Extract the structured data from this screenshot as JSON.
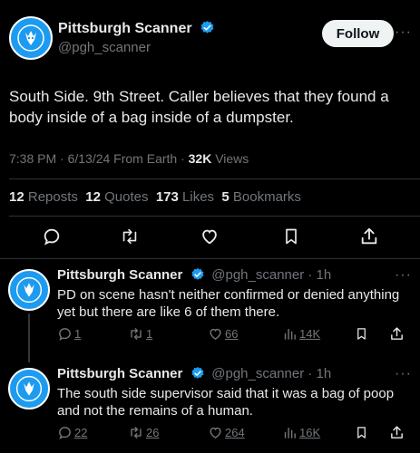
{
  "main_tweet": {
    "author_name": "Pittsburgh Scanner",
    "handle": "@pgh_scanner",
    "follow_label": "Follow",
    "more_label": "···",
    "text": "South Side.  9th Street.  Caller believes that they found a body inside of a bag inside of a dumpster.",
    "meta": {
      "time_date_source": "7:38 PM · 6/13/24 From Earth · ",
      "views_count": "32K",
      "views_label": " Views"
    },
    "stats": {
      "reposts_count": "12",
      "reposts_label": "Reposts",
      "quotes_count": "12",
      "quotes_label": "Quotes",
      "likes_count": "173",
      "likes_label": "Likes",
      "bookmarks_count": "5",
      "bookmarks_label": "Bookmarks"
    },
    "actions": [
      "reply-icon",
      "repost-icon",
      "like-icon",
      "bookmark-icon",
      "share-icon"
    ]
  },
  "replies": [
    {
      "author_name": "Pittsburgh Scanner",
      "handle_time": "@pgh_scanner · 1h",
      "more_label": "···",
      "text": "PD on scene hasn't neither confirmed or denied anything yet but there are like 6 of them there.",
      "counts": {
        "reply": "1",
        "repost": "1",
        "like": "66",
        "views": "14K"
      }
    },
    {
      "author_name": "Pittsburgh Scanner",
      "handle_time": "@pgh_scanner · 1h",
      "more_label": "···",
      "text": "The south side supervisor said that it was a bag of poop and not the remains of a human.",
      "counts": {
        "reply": "22",
        "repost": "26",
        "like": "264",
        "views": "16K"
      }
    }
  ],
  "colors": {
    "background": "#000000",
    "text": "#e7e9ea",
    "muted": "#71767b",
    "verified": "#1d9bf0",
    "divider": "#2f3336",
    "avatar": "#1d9bf0"
  }
}
